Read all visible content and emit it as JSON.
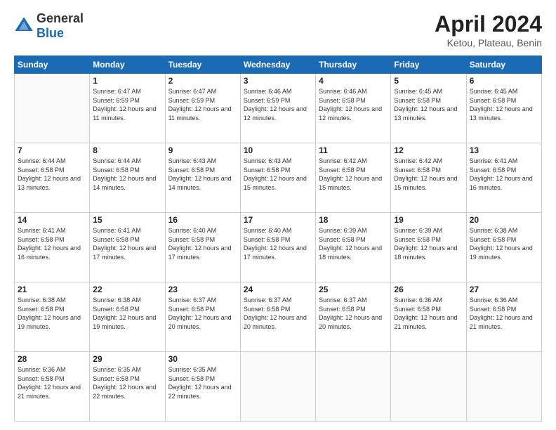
{
  "header": {
    "logo_general": "General",
    "logo_blue": "Blue",
    "month_year": "April 2024",
    "location": "Ketou, Plateau, Benin"
  },
  "days_of_week": [
    "Sunday",
    "Monday",
    "Tuesday",
    "Wednesday",
    "Thursday",
    "Friday",
    "Saturday"
  ],
  "weeks": [
    [
      {
        "day": "",
        "sunrise": "",
        "sunset": "",
        "daylight": ""
      },
      {
        "day": "1",
        "sunrise": "Sunrise: 6:47 AM",
        "sunset": "Sunset: 6:59 PM",
        "daylight": "Daylight: 12 hours and 11 minutes."
      },
      {
        "day": "2",
        "sunrise": "Sunrise: 6:47 AM",
        "sunset": "Sunset: 6:59 PM",
        "daylight": "Daylight: 12 hours and 11 minutes."
      },
      {
        "day": "3",
        "sunrise": "Sunrise: 6:46 AM",
        "sunset": "Sunset: 6:59 PM",
        "daylight": "Daylight: 12 hours and 12 minutes."
      },
      {
        "day": "4",
        "sunrise": "Sunrise: 6:46 AM",
        "sunset": "Sunset: 6:58 PM",
        "daylight": "Daylight: 12 hours and 12 minutes."
      },
      {
        "day": "5",
        "sunrise": "Sunrise: 6:45 AM",
        "sunset": "Sunset: 6:58 PM",
        "daylight": "Daylight: 12 hours and 13 minutes."
      },
      {
        "day": "6",
        "sunrise": "Sunrise: 6:45 AM",
        "sunset": "Sunset: 6:58 PM",
        "daylight": "Daylight: 12 hours and 13 minutes."
      }
    ],
    [
      {
        "day": "7",
        "sunrise": "Sunrise: 6:44 AM",
        "sunset": "Sunset: 6:58 PM",
        "daylight": "Daylight: 12 hours and 13 minutes."
      },
      {
        "day": "8",
        "sunrise": "Sunrise: 6:44 AM",
        "sunset": "Sunset: 6:58 PM",
        "daylight": "Daylight: 12 hours and 14 minutes."
      },
      {
        "day": "9",
        "sunrise": "Sunrise: 6:43 AM",
        "sunset": "Sunset: 6:58 PM",
        "daylight": "Daylight: 12 hours and 14 minutes."
      },
      {
        "day": "10",
        "sunrise": "Sunrise: 6:43 AM",
        "sunset": "Sunset: 6:58 PM",
        "daylight": "Daylight: 12 hours and 15 minutes."
      },
      {
        "day": "11",
        "sunrise": "Sunrise: 6:42 AM",
        "sunset": "Sunset: 6:58 PM",
        "daylight": "Daylight: 12 hours and 15 minutes."
      },
      {
        "day": "12",
        "sunrise": "Sunrise: 6:42 AM",
        "sunset": "Sunset: 6:58 PM",
        "daylight": "Daylight: 12 hours and 15 minutes."
      },
      {
        "day": "13",
        "sunrise": "Sunrise: 6:41 AM",
        "sunset": "Sunset: 6:58 PM",
        "daylight": "Daylight: 12 hours and 16 minutes."
      }
    ],
    [
      {
        "day": "14",
        "sunrise": "Sunrise: 6:41 AM",
        "sunset": "Sunset: 6:58 PM",
        "daylight": "Daylight: 12 hours and 16 minutes."
      },
      {
        "day": "15",
        "sunrise": "Sunrise: 6:41 AM",
        "sunset": "Sunset: 6:58 PM",
        "daylight": "Daylight: 12 hours and 17 minutes."
      },
      {
        "day": "16",
        "sunrise": "Sunrise: 6:40 AM",
        "sunset": "Sunset: 6:58 PM",
        "daylight": "Daylight: 12 hours and 17 minutes."
      },
      {
        "day": "17",
        "sunrise": "Sunrise: 6:40 AM",
        "sunset": "Sunset: 6:58 PM",
        "daylight": "Daylight: 12 hours and 17 minutes."
      },
      {
        "day": "18",
        "sunrise": "Sunrise: 6:39 AM",
        "sunset": "Sunset: 6:58 PM",
        "daylight": "Daylight: 12 hours and 18 minutes."
      },
      {
        "day": "19",
        "sunrise": "Sunrise: 6:39 AM",
        "sunset": "Sunset: 6:58 PM",
        "daylight": "Daylight: 12 hours and 18 minutes."
      },
      {
        "day": "20",
        "sunrise": "Sunrise: 6:38 AM",
        "sunset": "Sunset: 6:58 PM",
        "daylight": "Daylight: 12 hours and 19 minutes."
      }
    ],
    [
      {
        "day": "21",
        "sunrise": "Sunrise: 6:38 AM",
        "sunset": "Sunset: 6:58 PM",
        "daylight": "Daylight: 12 hours and 19 minutes."
      },
      {
        "day": "22",
        "sunrise": "Sunrise: 6:38 AM",
        "sunset": "Sunset: 6:58 PM",
        "daylight": "Daylight: 12 hours and 19 minutes."
      },
      {
        "day": "23",
        "sunrise": "Sunrise: 6:37 AM",
        "sunset": "Sunset: 6:58 PM",
        "daylight": "Daylight: 12 hours and 20 minutes."
      },
      {
        "day": "24",
        "sunrise": "Sunrise: 6:37 AM",
        "sunset": "Sunset: 6:58 PM",
        "daylight": "Daylight: 12 hours and 20 minutes."
      },
      {
        "day": "25",
        "sunrise": "Sunrise: 6:37 AM",
        "sunset": "Sunset: 6:58 PM",
        "daylight": "Daylight: 12 hours and 20 minutes."
      },
      {
        "day": "26",
        "sunrise": "Sunrise: 6:36 AM",
        "sunset": "Sunset: 6:58 PM",
        "daylight": "Daylight: 12 hours and 21 minutes."
      },
      {
        "day": "27",
        "sunrise": "Sunrise: 6:36 AM",
        "sunset": "Sunset: 6:58 PM",
        "daylight": "Daylight: 12 hours and 21 minutes."
      }
    ],
    [
      {
        "day": "28",
        "sunrise": "Sunrise: 6:36 AM",
        "sunset": "Sunset: 6:58 PM",
        "daylight": "Daylight: 12 hours and 21 minutes."
      },
      {
        "day": "29",
        "sunrise": "Sunrise: 6:35 AM",
        "sunset": "Sunset: 6:58 PM",
        "daylight": "Daylight: 12 hours and 22 minutes."
      },
      {
        "day": "30",
        "sunrise": "Sunrise: 6:35 AM",
        "sunset": "Sunset: 6:58 PM",
        "daylight": "Daylight: 12 hours and 22 minutes."
      },
      {
        "day": "",
        "sunrise": "",
        "sunset": "",
        "daylight": ""
      },
      {
        "day": "",
        "sunrise": "",
        "sunset": "",
        "daylight": ""
      },
      {
        "day": "",
        "sunrise": "",
        "sunset": "",
        "daylight": ""
      },
      {
        "day": "",
        "sunrise": "",
        "sunset": "",
        "daylight": ""
      }
    ]
  ]
}
